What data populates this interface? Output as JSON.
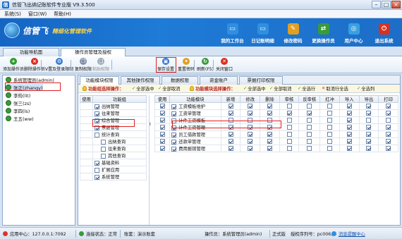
{
  "window": {
    "title": "信管飞出纳记账软件专业版 V9.3.500"
  },
  "menu": [
    "系统(S)",
    "窗口(W)",
    "帮助(H)"
  ],
  "brand": {
    "name": "信管飞",
    "slogan": "精细化管理软件"
  },
  "topnav": [
    {
      "label": "我的工作台",
      "icon": "monitor-icon",
      "color": "#2f8fe0"
    },
    {
      "label": "日记账明细",
      "icon": "monitor-icon",
      "color": "#2f8fe0"
    },
    {
      "label": "修改密码",
      "icon": "lock-icon",
      "color": "#e0a020"
    },
    {
      "label": "更换操作员",
      "icon": "user-switch-icon",
      "color": "#3a9a3a"
    },
    {
      "label": "用户中心",
      "icon": "globe-icon",
      "color": "#3aa0e0"
    },
    {
      "label": "退出系统",
      "icon": "power-icon",
      "color": "#d83020"
    }
  ],
  "main_tabs": [
    "功能导航面",
    "操作员管理及授权"
  ],
  "toolbar": [
    {
      "label": "添加操作员",
      "icon": "add-icon",
      "color": "#2f9a2f",
      "disabled": false
    },
    {
      "label": "删除操作员",
      "icon": "delete-icon",
      "color": "#d83020",
      "disabled": false
    },
    {
      "label": "V置及登录限制",
      "icon": "settings-icon",
      "color": "#3a7fd0",
      "disabled": false
    },
    {
      "label": "复制权限",
      "icon": "copy-icon",
      "color": "#7f8fa8",
      "disabled": false
    },
    {
      "label": "粘贴权限",
      "icon": "paste-icon",
      "color": "#9aa6b8",
      "disabled": true
    },
    {
      "label": "保存设置",
      "icon": "save-icon",
      "color": "#2f6fd0",
      "disabled": false
    },
    {
      "label": "重置密码",
      "icon": "key-icon",
      "color": "#e0a020",
      "disabled": false
    },
    {
      "label": "刷新(F5)",
      "icon": "refresh-icon",
      "color": "#3a9a3a",
      "disabled": false
    },
    {
      "label": "关闭窗口",
      "icon": "close-icon",
      "color": "#d83020",
      "disabled": false
    }
  ],
  "users": [
    {
      "label": "系统管理员(admin)",
      "selected": false
    },
    {
      "label": "张正(zhangy)",
      "selected": true
    },
    {
      "label": "李筠(lit)",
      "selected": false
    },
    {
      "label": "张三(zs)",
      "selected": false
    },
    {
      "label": "李四(ls)",
      "selected": false
    },
    {
      "label": "王五(ww)",
      "selected": false
    }
  ],
  "perm_tabs": [
    "功能模块权限",
    "其他操作权限",
    "数据权限",
    "资金账户",
    "票据打印权限"
  ],
  "subbar": {
    "group_title": "功能组选择操作：",
    "group_all": "全部选中",
    "group_none": "全部取消",
    "module_title": "功能模块选择操作：",
    "module_all": "全部选中",
    "module_none": "全部取消",
    "select_all": "全选行",
    "cancel_all": "取消行全选",
    "select_col": "全选列"
  },
  "groups_header": [
    "使用",
    "功能组"
  ],
  "groups": [
    {
      "name": "出纳管理",
      "checked": true,
      "indent": 0
    },
    {
      "name": "往来管理",
      "checked": true,
      "indent": 0
    },
    {
      "name": "综合管理",
      "checked": true,
      "indent": 0
    },
    {
      "name": "票据管理",
      "checked": true,
      "indent": 0
    },
    {
      "name": "统计查询",
      "checked": false,
      "indent": 0
    },
    {
      "name": "出纳查询",
      "checked": false,
      "indent": 1
    },
    {
      "name": "往来查询",
      "checked": false,
      "indent": 1
    },
    {
      "name": "其他查询",
      "checked": false,
      "indent": 1
    },
    {
      "name": "基础资料",
      "checked": true,
      "indent": 0
    },
    {
      "name": "扩展应用",
      "checked": false,
      "indent": 0
    },
    {
      "name": "系统管理",
      "checked": true,
      "indent": 0
    }
  ],
  "modules_header": [
    "使用",
    "功能模块",
    "新增",
    "修改",
    "删除",
    "审核",
    "反审核",
    "红冲",
    "导入",
    "导出",
    "打印"
  ],
  "modules": [
    {
      "name": "工资模板维护",
      "flags": [
        true,
        true,
        true,
        true,
        false,
        false,
        false,
        true,
        true,
        true
      ]
    },
    {
      "name": "工资单管理",
      "flags": [
        true,
        true,
        true,
        true,
        true,
        true,
        false,
        true,
        true,
        true
      ]
    },
    {
      "name": "计件工资模板",
      "flags": [
        false,
        false,
        false,
        false,
        false,
        false,
        false,
        true,
        false,
        false
      ]
    },
    {
      "name": "计件工资管理",
      "flags": [
        true,
        true,
        true,
        true,
        false,
        false,
        false,
        true,
        true,
        true
      ]
    },
    {
      "name": "员工借款管理",
      "flags": [
        true,
        true,
        true,
        true,
        false,
        false,
        false,
        true,
        true,
        true
      ]
    },
    {
      "name": "还款单管理",
      "flags": [
        true,
        true,
        true,
        true,
        false,
        false,
        false,
        true,
        true,
        true
      ]
    },
    {
      "name": "费用报销管理",
      "flags": [
        true,
        true,
        true,
        true,
        false,
        false,
        false,
        true,
        true,
        true
      ]
    }
  ],
  "status": {
    "app_center": "应用中心：127.0.0.1:7092",
    "conn_label": "连接状态：",
    "conn_value": "正常",
    "account": "账套：演示账套",
    "operator": "操作员：系统管理员(admin)",
    "edition": "正式版",
    "license": "授权序列号：pc006,",
    "message": "消息提醒中心"
  },
  "colors": {
    "banner": "#1565c4",
    "highlight": "#e02020",
    "check": "#1f3f7a"
  }
}
